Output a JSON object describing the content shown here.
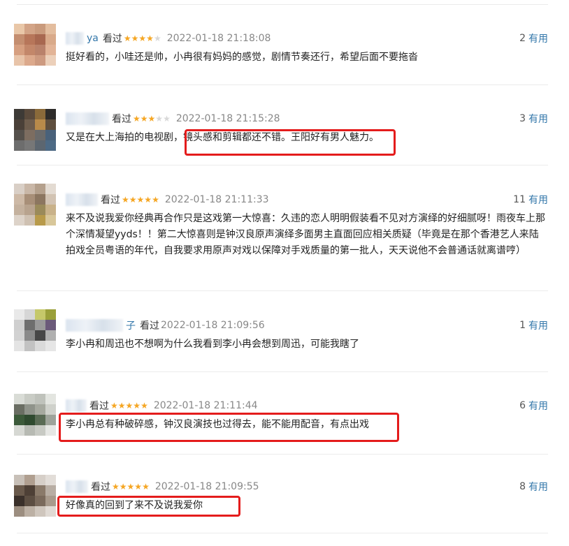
{
  "comments": [
    {
      "user_visible": "ya",
      "watched_label": "看过",
      "rating": 4,
      "time": "2022-01-18 21:18:08",
      "votes": "2",
      "vote_label": "有用",
      "text": "挺好看的，小哇还是帅，小冉很有妈妈的感觉，剧情节奏还行，希望后面不要拖沓"
    },
    {
      "user_visible": "",
      "watched_label": "看过",
      "rating": 3,
      "time": "2022-01-18 21:15:28",
      "votes": "3",
      "vote_label": "有用",
      "text": "又是在大上海拍的电视剧，镜头感和剪辑都还不错。王阳好有男人魅力。"
    },
    {
      "user_visible": "",
      "watched_label": "看过",
      "rating": 5,
      "time": "2022-01-18 21:11:33",
      "votes": "11",
      "vote_label": "有用",
      "text": "来不及说我爱你经典再合作只是这戏第一大惊喜：久违的恋人明明假装看不见对方演绎的好细腻呀！雨夜车上那个深情凝望yyds！！第二大惊喜则是钟汉良原声演绎多面男主直面回应相关质疑（毕竟是在那个香港艺人来陆拍戏全员粤语的年代，自我要求用原声对戏以保障对手戏质量的第一批人，天天说他不会普通话就离谱哼）"
    },
    {
      "user_visible": "子",
      "watched_label": "看过",
      "rating": 0,
      "time": "2022-01-18 21:09:56",
      "votes": "1",
      "vote_label": "有用",
      "text": "李小冉和周迅也不想啊为什么我看到李小冉会想到周迅，可能我瞎了"
    },
    {
      "user_visible": "",
      "watched_label": "看过",
      "rating": 5,
      "time": "2022-01-18 21:11:44",
      "votes": "6",
      "vote_label": "有用",
      "text": "李小冉总有种破碎感，钟汉良演技也过得去，能不能用配音，有点出戏"
    },
    {
      "user_visible": "",
      "watched_label": "看过",
      "rating": 5,
      "time": "2022-01-18 21:09:55",
      "votes": "8",
      "vote_label": "有用",
      "text": "好像真的回到了来不及说我爱你"
    }
  ],
  "colors": {
    "star": "#f5a623",
    "link": "#3377aa",
    "highlight": "#e41c1c"
  }
}
